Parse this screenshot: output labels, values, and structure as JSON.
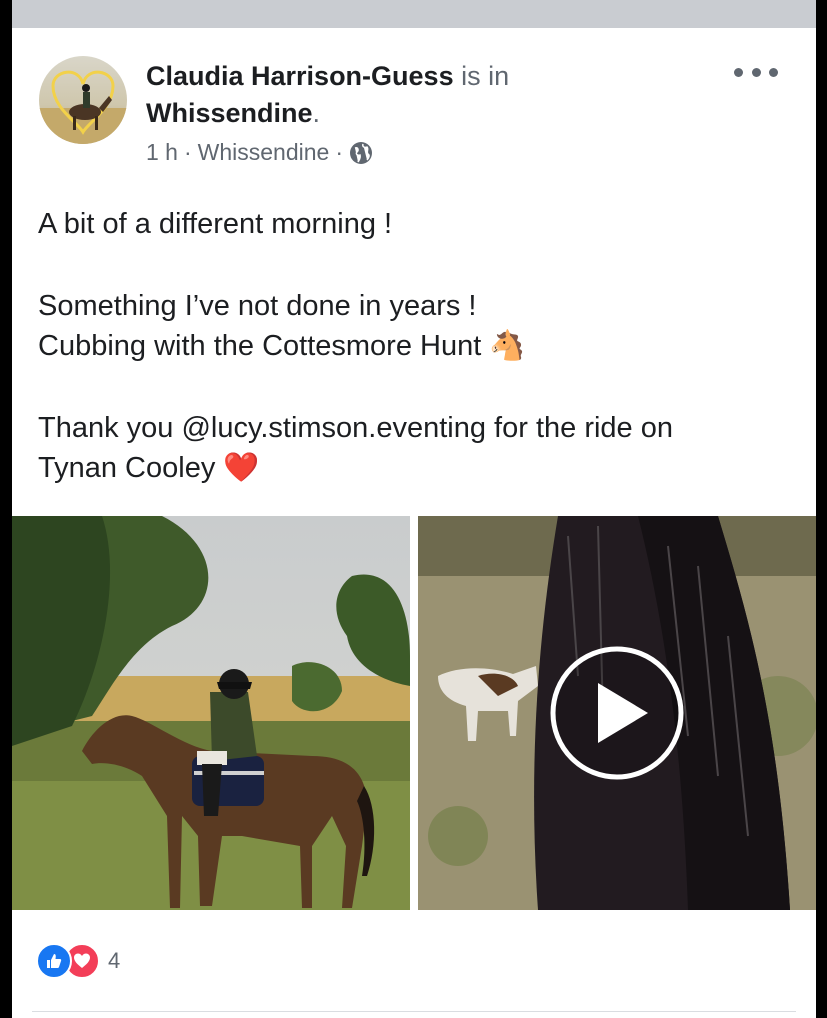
{
  "post": {
    "author_name": "Claudia Harrison-Guess",
    "is_in_text": "is in",
    "location": "Whissendine",
    "period": ".",
    "time": "1 h",
    "separator": "·",
    "meta_location": "Whissendine",
    "privacy_icon": "globe-icon",
    "lines": {
      "l1": "A bit of a different morning !",
      "l2": "Something I’ve not done in years !",
      "l3": "Cubbing with the Cottesmore Hunt",
      "l4": "Thank you @lucy.stimson.eventing for the ride on",
      "l5": "Tynan Cooley"
    },
    "emoji_horse": "🐴",
    "emoji_heart": "❤️",
    "photos": [
      {
        "kind": "image",
        "subject": "rider on bay horse in field"
      },
      {
        "kind": "video",
        "subject": "horse mane with hounds",
        "play_icon": "play-icon"
      }
    ]
  },
  "reactions": {
    "icons": [
      "like-icon",
      "love-icon"
    ],
    "count": "4"
  },
  "colors": {
    "like": "#1877f2",
    "love": "#f33e58",
    "text": "#1c1e21",
    "meta": "#606770",
    "topbar": "#c9ccd1"
  }
}
